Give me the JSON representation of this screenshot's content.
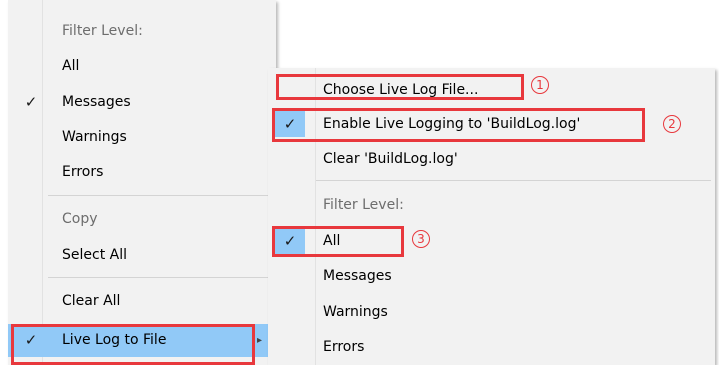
{
  "left_menu": {
    "filter_header": "Filter Level:",
    "items": [
      {
        "label": "All",
        "checked": false
      },
      {
        "label": "Messages",
        "checked": true
      },
      {
        "label": "Warnings",
        "checked": false
      },
      {
        "label": "Errors",
        "checked": false
      }
    ],
    "copy_label": "Copy",
    "select_all_label": "Select All",
    "clear_all_label": "Clear All",
    "live_log_label": "Live Log to File",
    "check_glyph": "✓"
  },
  "right_menu": {
    "choose_file_label": "Choose Live Log File...",
    "enable_logging_label": "Enable Live Logging to 'BuildLog.log'",
    "clear_log_label": "Clear 'BuildLog.log'",
    "filter_header": "Filter Level:",
    "items": [
      {
        "label": "All",
        "checked": true
      },
      {
        "label": "Messages",
        "checked": false
      },
      {
        "label": "Warnings",
        "checked": false
      },
      {
        "label": "Errors",
        "checked": false
      }
    ]
  },
  "annotations": {
    "marker_1": "1",
    "marker_2": "2",
    "marker_3": "3",
    "color": "#e8383d"
  },
  "colors": {
    "menu_bg": "#f2f2f2",
    "highlight": "#91c9f7",
    "disabled_text": "#6d6d6d"
  }
}
